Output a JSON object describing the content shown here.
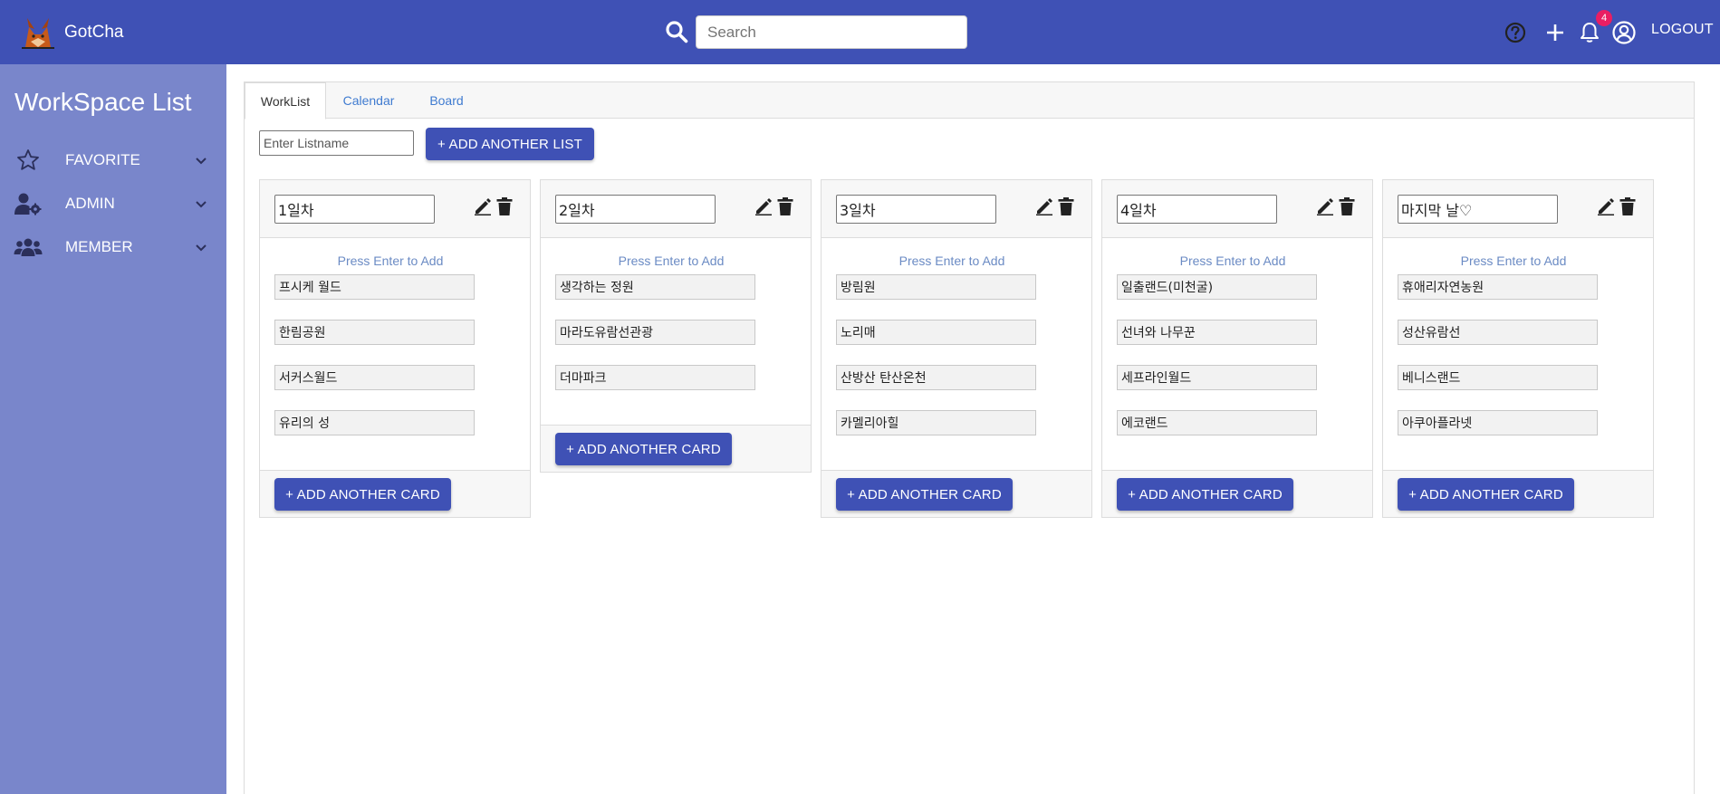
{
  "app": {
    "name": "GotCha"
  },
  "search": {
    "placeholder": "Search"
  },
  "notifications": {
    "count": "4"
  },
  "header": {
    "logout_label": "LOGOUT"
  },
  "sidebar": {
    "title": "WorkSpace List",
    "items": [
      {
        "label": "FAVORITE",
        "icon": "star-icon"
      },
      {
        "label": "ADMIN",
        "icon": "user-gear-icon"
      },
      {
        "label": "MEMBER",
        "icon": "users-icon"
      }
    ]
  },
  "tabs": [
    {
      "label": "WorkList",
      "active": true
    },
    {
      "label": "Calendar",
      "active": false
    },
    {
      "label": "Board",
      "active": false
    }
  ],
  "toolbar": {
    "listname_placeholder": "Enter Listname",
    "add_list_label": "+ ADD ANOTHER LIST"
  },
  "add_card_label": "+ ADD ANOTHER CARD",
  "hint_text": "Press Enter to Add",
  "lists": [
    {
      "title": "1일차",
      "cards": [
        "프시케 월드",
        "한림공원",
        "서커스월드",
        "유리의 성"
      ]
    },
    {
      "title": "2일차",
      "cards": [
        "생각하는 정원",
        "마라도유람선관광",
        "더마파크"
      ]
    },
    {
      "title": "3일차",
      "cards": [
        "방림원",
        "노리매",
        "산방산 탄산온천",
        "카멜리아힐"
      ]
    },
    {
      "title": "4일차",
      "cards": [
        "일출랜드(미천굴)",
        "선녀와 나무꾼",
        "세프라인월드",
        "에코랜드"
      ]
    },
    {
      "title": "마지막 날♡",
      "cards": [
        "휴애리자연농원",
        "성산유람선",
        "베니스랜드",
        "아쿠아플라넷"
      ]
    }
  ],
  "colors": {
    "primary": "#3f51b5",
    "sidebar": "#7986cb",
    "badge": "#e91e63",
    "link": "#3f7bd0"
  }
}
